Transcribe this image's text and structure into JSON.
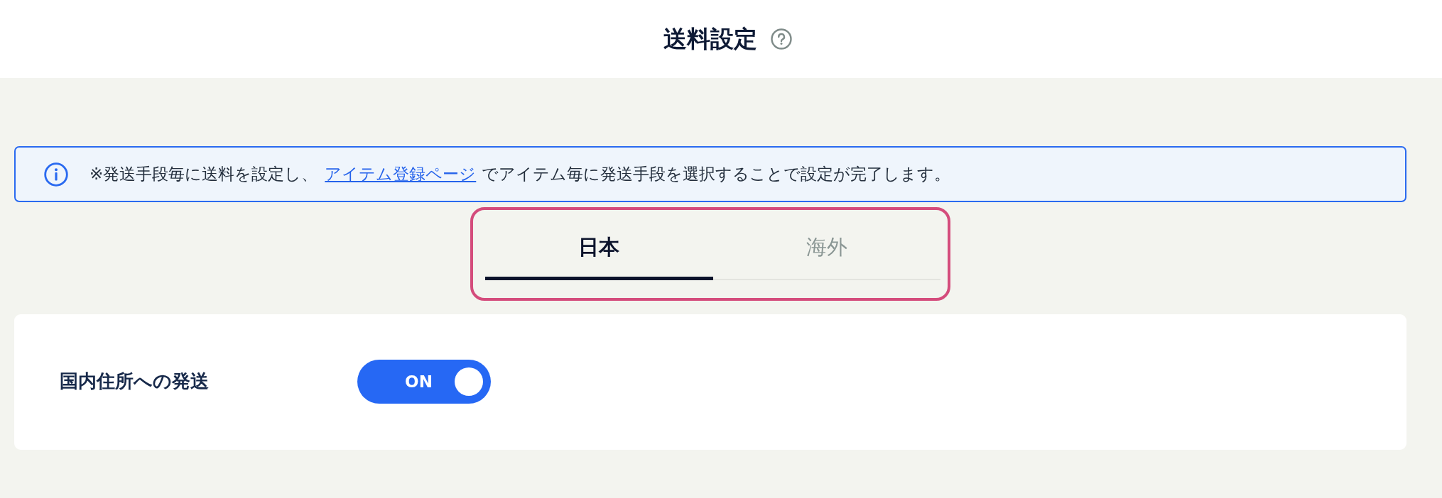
{
  "header": {
    "title": "送料設定"
  },
  "notice": {
    "text_before": "※発送手段毎に送料を設定し、",
    "link": "アイテム登録ページ",
    "text_after": "でアイテム毎に発送手段を選択することで設定が完了します。"
  },
  "tab_bar": {
    "highlighted": true,
    "tabs": [
      {
        "label": "日本",
        "selected": true
      },
      {
        "label": "海外",
        "selected": false
      }
    ]
  },
  "settings": [
    {
      "kind": "toggle",
      "label": "国内住所への発送",
      "on": true,
      "state_label": "ON"
    }
  ]
}
